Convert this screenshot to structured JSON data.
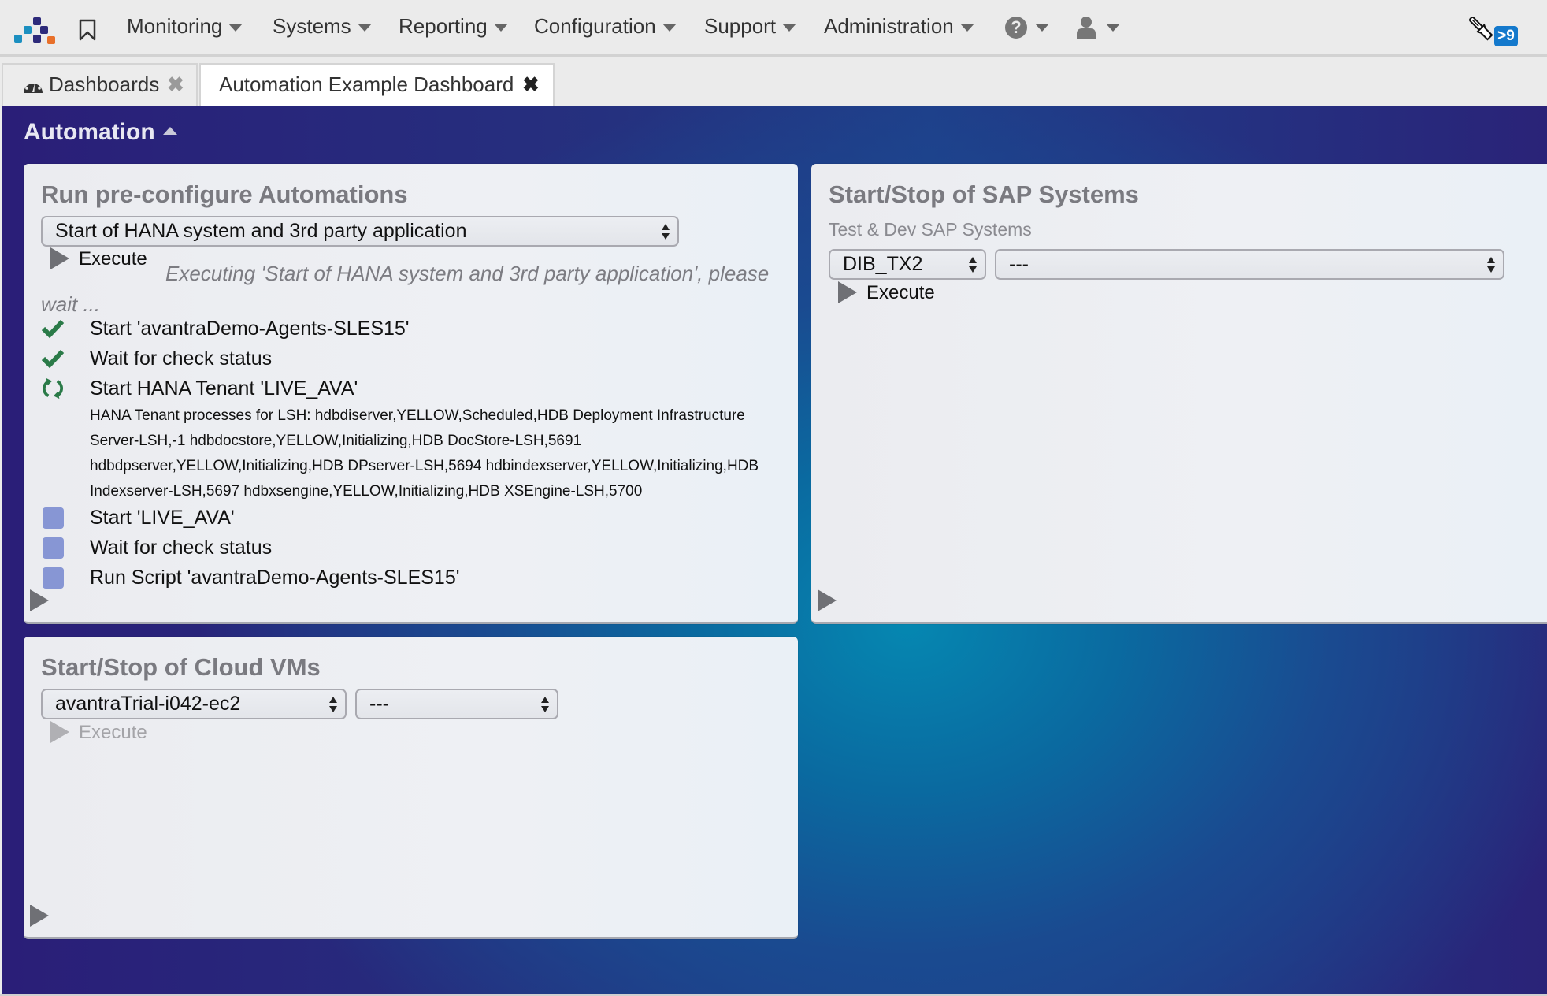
{
  "nav": {
    "logo_colors": {
      "light_blue": "#1b8fc0",
      "navy": "#2d2a7a",
      "orange": "#e8702a"
    },
    "bookmark_icon": "bookmark-icon",
    "menus": [
      {
        "label": "Monitoring"
      },
      {
        "label": "Systems"
      },
      {
        "label": "Reporting"
      },
      {
        "label": "Configuration"
      },
      {
        "label": "Support"
      },
      {
        "label": "Administration"
      }
    ],
    "help_glyph": "?",
    "notification_badge": ">9",
    "badge_color": "#1479cc"
  },
  "tabs": [
    {
      "label": "Dashboards",
      "close": "✖",
      "active": false
    },
    {
      "label": "Automation Example Dashboard",
      "close": "✖",
      "active": true
    }
  ],
  "dashboard": {
    "section_title": "Automation",
    "panels": {
      "automations": {
        "title": "Run pre-configure Automations",
        "selected": "Start of HANA system and 3rd party application",
        "execute_label": "Execute",
        "status_message": "Executing 'Start of HANA system and 3rd party application', please wait ...",
        "steps": [
          {
            "label": "Start 'avantraDemo-Agents-SLES15'",
            "status": "done"
          },
          {
            "label": "Wait for check status",
            "status": "done"
          },
          {
            "label": "Start HANA Tenant 'LIVE_AVA'",
            "status": "running"
          },
          {
            "label": "Start 'LIVE_AVA'",
            "status": "pending"
          },
          {
            "label": "Wait for check status",
            "status": "pending"
          },
          {
            "label": "Run Script 'avantraDemo-Agents-SLES15'",
            "status": "pending"
          }
        ],
        "running_detail": "HANA Tenant processes for LSH: hdbdiserver,YELLOW,Scheduled,HDB Deployment Infrastructure Server-LSH,-1 hdbdocstore,YELLOW,Initializing,HDB DocStore-LSH,5691 hdbdpserver,YELLOW,Initializing,HDB DPserver-LSH,5694 hdbindexserver,YELLOW,Initializing,HDB Indexserver-LSH,5697 hdbxsengine,YELLOW,Initializing,HDB XSEngine-LSH,5700"
      },
      "sap_systems": {
        "title": "Start/Stop of SAP Systems",
        "subtitle": "Test & Dev SAP Systems",
        "system_selected": "DIB_TX2",
        "action_selected": "---",
        "execute_label": "Execute"
      },
      "cloud_vms": {
        "title": "Start/Stop of Cloud VMs",
        "vm_selected": "avantraTrial-i042-ec2",
        "action_selected": "---",
        "execute_label": "Execute",
        "execute_enabled": false
      }
    },
    "colors": {
      "done": "#2a7a48",
      "pending": "#8796d4",
      "gradient_center": "#0587b1",
      "gradient_edge": "#2a1e78"
    }
  }
}
